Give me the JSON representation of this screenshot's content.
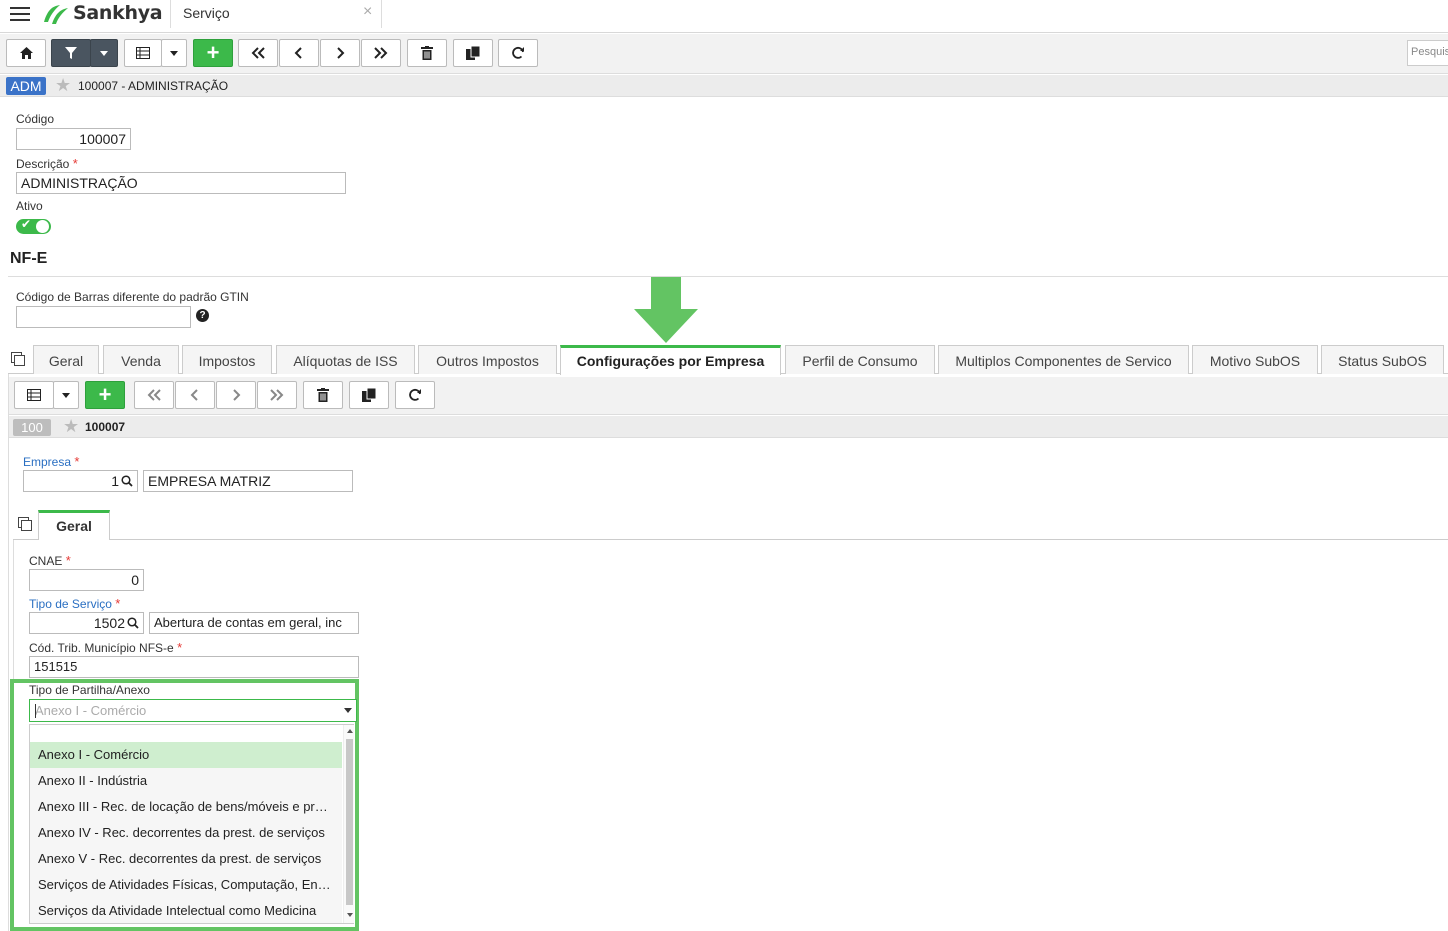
{
  "app": {
    "brand": "Sankhya",
    "tab_title": "Serviço",
    "tab_close": "×"
  },
  "toolbar": {
    "search_placeholder": "Pesquis",
    "buttons": [
      "home-icon",
      "filter-icon",
      "chevron-down-icon",
      "grid-icon",
      "chevron-down-icon",
      "plus-icon",
      "double-chevron-left-icon",
      "chevron-left-icon",
      "chevron-right-icon",
      "double-chevron-right-icon",
      "trash-icon",
      "copy-icon",
      "refresh-icon"
    ]
  },
  "breadcrumb": {
    "badge": "ADM",
    "text": "100007 - ADMINISTRAÇÃO"
  },
  "form": {
    "codigo_label": "Código",
    "codigo_value": "100007",
    "descricao_label": "Descrição",
    "descricao_value": "ADMINISTRAÇÃO",
    "ativo_label": "Ativo",
    "ativo_value": true,
    "required_mark": "*"
  },
  "nfe": {
    "title": "NF-E",
    "gtin_label": "Código de Barras diferente do padrão GTIN",
    "gtin_value": "",
    "help": "?"
  },
  "tabs": [
    {
      "label": "Geral",
      "active": false
    },
    {
      "label": "Venda",
      "active": false
    },
    {
      "label": "Impostos",
      "active": false
    },
    {
      "label": "Alíquotas de ISS",
      "active": false
    },
    {
      "label": "Outros Impostos",
      "active": false
    },
    {
      "label": "Configurações por Empresa",
      "active": true
    },
    {
      "label": "Perfil de Consumo",
      "active": false
    },
    {
      "label": "Multiplos Componentes de Servico",
      "active": false
    },
    {
      "label": "Motivo SubOS",
      "active": false
    },
    {
      "label": "Status SubOS",
      "active": false
    }
  ],
  "inner": {
    "badge": "100",
    "crumb_text": "100007",
    "empresa_label": "Empresa",
    "empresa_code": "1",
    "empresa_name": "EMPRESA MATRIZ",
    "subtab": "Geral",
    "cnae_label": "CNAE",
    "cnae_value": "0",
    "tipo_servico_label": "Tipo de Serviço",
    "tipo_servico_code": "1502",
    "tipo_servico_desc": "Abertura de contas em geral, inc",
    "cod_trib_label": "Cód. Trib. Município NFS-e",
    "cod_trib_value": "151515",
    "partilha_label": "Tipo de Partilha/Anexo",
    "partilha_placeholder": "Anexo I - Comércio"
  },
  "dropdown": {
    "options": [
      "Anexo I - Comércio",
      "Anexo II - Indústria",
      "Anexo III - Rec. de locação de bens/móveis e prest. de serviços",
      "Anexo IV - Rec. decorrentes da prest. de serviços",
      "Anexo V - Rec. decorrentes da prest. de serviços",
      "Serviços de Atividades Físicas, Computação, Engenharia",
      "Serviços da Atividade Intelectual como Medicina"
    ],
    "selected_index": 0
  },
  "colors": {
    "accent_green": "#3cb94a",
    "highlight_green": "#63c463",
    "link_blue": "#2a6fc2",
    "badge_blue": "#3b73c8"
  }
}
